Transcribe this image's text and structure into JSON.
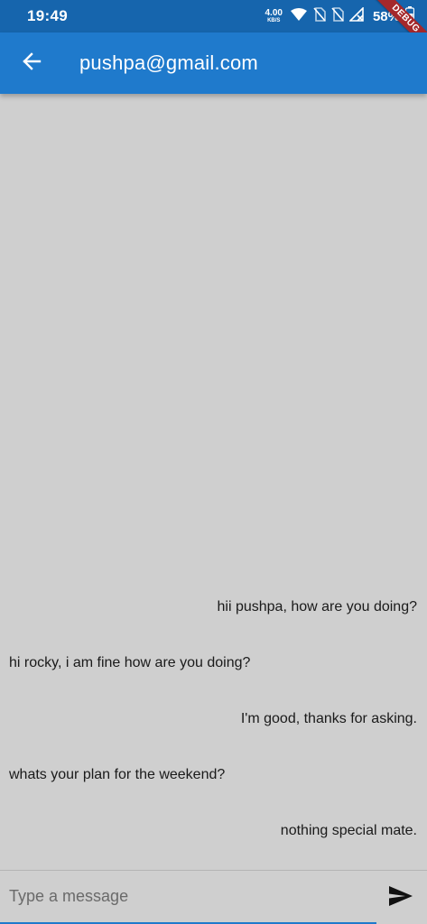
{
  "status_bar": {
    "time": "19:49",
    "net_speed_value": "4.00",
    "net_speed_unit": "KB/S",
    "battery": "58%",
    "icons": [
      "wifi-icon",
      "no-sim-icon",
      "no-sim-icon",
      "no-signal-icon",
      "battery-icon"
    ]
  },
  "debug_banner": "DEBUG",
  "app_bar": {
    "back_icon": "arrow-back-icon",
    "title": "pushpa@gmail.com"
  },
  "messages": [
    {
      "text": "hii pushpa, how are you doing?",
      "side": "sent"
    },
    {
      "text": "hi rocky, i am fine how are you doing?",
      "side": "received"
    },
    {
      "text": "I'm good, thanks for asking.",
      "side": "sent"
    },
    {
      "text": "whats your plan for the weekend?",
      "side": "received"
    },
    {
      "text": "nothing special mate.",
      "side": "sent"
    }
  ],
  "composer": {
    "placeholder": "Type a message",
    "value": "",
    "send_icon": "send-icon"
  },
  "colors": {
    "status_bar": "#1665ad",
    "app_bar": "#1f7acc",
    "background": "#cfcfcf",
    "debug_ribbon": "#a4282b"
  }
}
